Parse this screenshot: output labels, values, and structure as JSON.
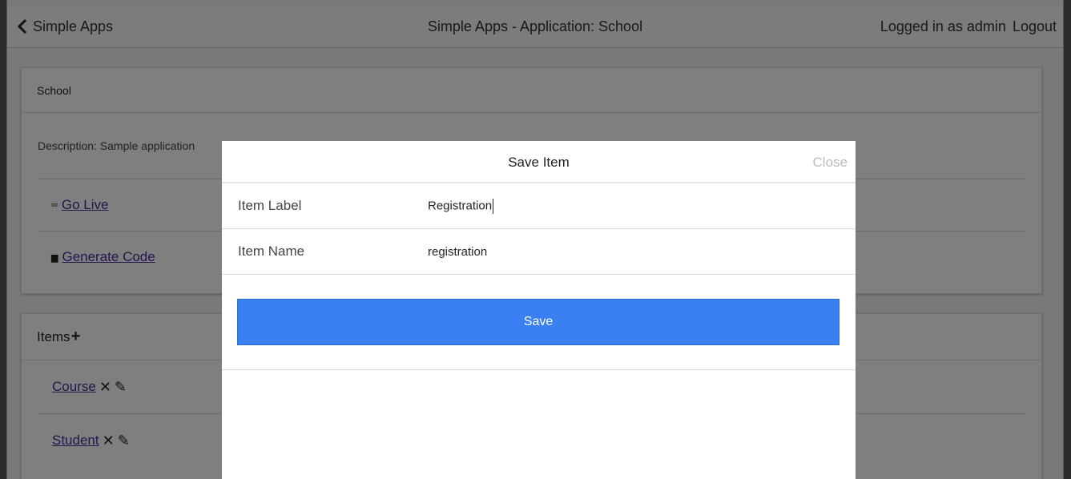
{
  "navbar": {
    "back_label": "Simple Apps",
    "title": "Simple Apps - Application: School",
    "logged_in": "Logged in as admin",
    "logout": "Logout"
  },
  "app_card": {
    "header": "School",
    "description": "Description: Sample application",
    "links": [
      {
        "icon": "link-icon",
        "label": "Go Live"
      },
      {
        "icon": "briefcase-icon",
        "label": "Generate Code"
      }
    ]
  },
  "items_card": {
    "header": "Items",
    "items": [
      {
        "label": "Course"
      },
      {
        "label": "Student"
      }
    ]
  },
  "modal": {
    "title": "Save Item",
    "close": "Close",
    "fields": {
      "label_caption": "Item Label",
      "label_value": "Registration",
      "name_caption": "Item Name",
      "name_value": "registration"
    },
    "save_label": "Save"
  },
  "colors": {
    "primary": "#3a80f3",
    "link": "#4b2a9a"
  }
}
